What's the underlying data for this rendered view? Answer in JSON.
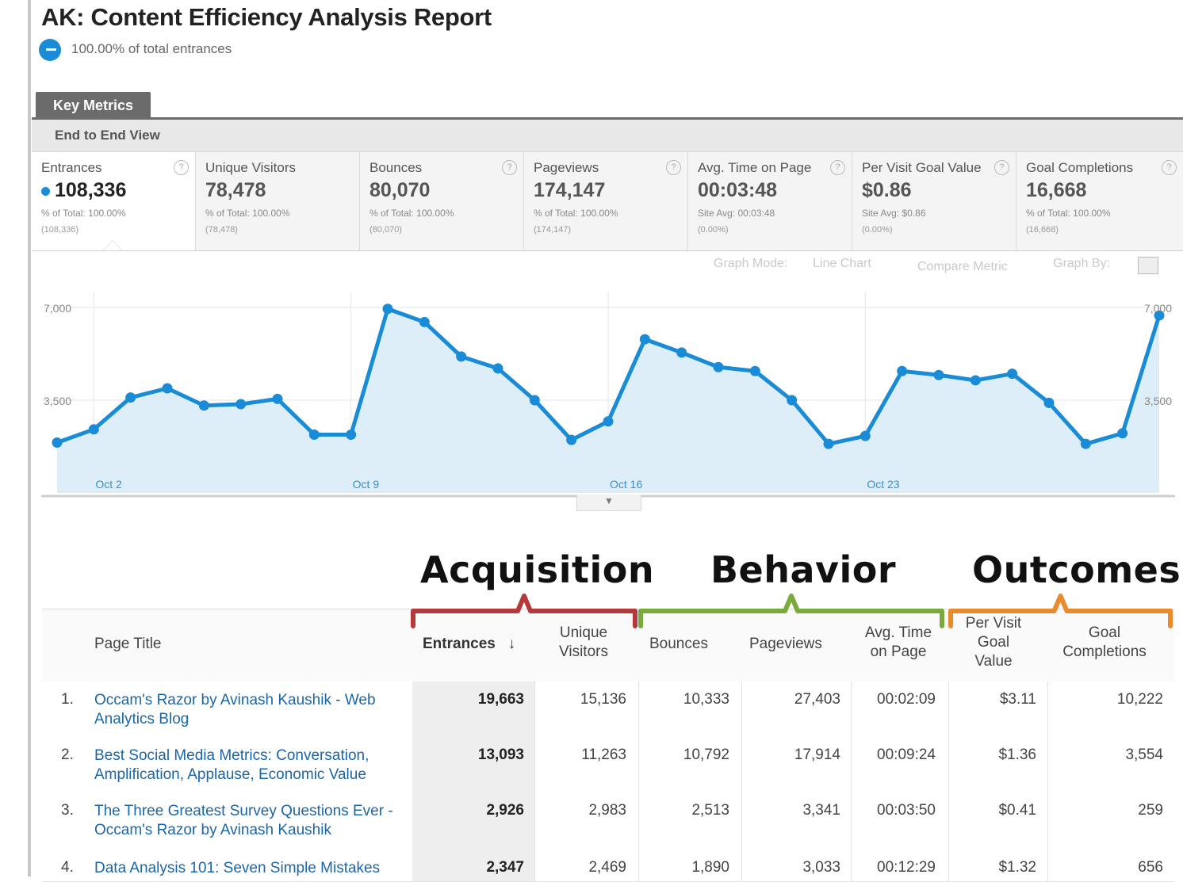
{
  "report": {
    "title": "AK: Content Efficiency Analysis Report",
    "segment_text": "100.00% of total entrances"
  },
  "tabs": {
    "key_metrics": "Key Metrics",
    "view": "End to End View"
  },
  "metrics": [
    {
      "name": "Entrances",
      "value": "108,336",
      "sub1": "% of Total: 100.00%",
      "sub2": "(108,336)"
    },
    {
      "name": "Unique Visitors",
      "value": "78,478",
      "sub1": "% of Total: 100.00%",
      "sub2": "(78,478)"
    },
    {
      "name": "Bounces",
      "value": "80,070",
      "sub1": "% of Total: 100.00%",
      "sub2": "(80,070)"
    },
    {
      "name": "Pageviews",
      "value": "174,147",
      "sub1": "% of Total: 100.00%",
      "sub2": "(174,147)"
    },
    {
      "name": "Avg. Time on Page",
      "value": "00:03:48",
      "sub1": "Site Avg: 00:03:48",
      "sub2": "(0.00%)"
    },
    {
      "name": "Per Visit Goal Value",
      "value": "$0.86",
      "sub1": "Site Avg: $0.86",
      "sub2": "(0.00%)"
    },
    {
      "name": "Goal Completions",
      "value": "16,668",
      "sub1": "% of Total: 100.00%",
      "sub2": "(16,668)"
    }
  ],
  "graph_controls": {
    "mode_label": "Graph Mode:",
    "mode_value": "Line Chart",
    "compare": "Compare Metric",
    "graph_by": "Graph By:"
  },
  "chart_data": {
    "type": "area",
    "series": [
      {
        "values": [
          1900,
          2400,
          3600,
          3950,
          3300,
          3350,
          3550,
          2200,
          2200,
          6950,
          6450,
          5150,
          4700,
          3500,
          2000,
          2700,
          5800,
          5300,
          4750,
          4600,
          3500,
          1850,
          2150,
          4600,
          4450,
          4250,
          4500,
          3400,
          1850,
          2250,
          6700
        ]
      }
    ],
    "y_ticks": [
      "7,000",
      "3,500"
    ],
    "ylim": [
      0,
      7600
    ],
    "x_labels": [
      {
        "index": 1,
        "label": "Oct 2"
      },
      {
        "index": 8,
        "label": "Oct 9"
      },
      {
        "index": 15,
        "label": "Oct 16"
      },
      {
        "index": 22,
        "label": "Oct 23"
      }
    ],
    "color": "#1a8bd6",
    "fill": "#ddeef9",
    "grid": true
  },
  "sections": {
    "acquisition": {
      "label": "Acquisition",
      "color": "#b5383a"
    },
    "behavior": {
      "label": "Behavior",
      "color": "#7aaa3c"
    },
    "outcomes": {
      "label": "Outcomes",
      "color": "#e98a2c"
    }
  },
  "table": {
    "headers": {
      "page_title": "Page Title",
      "entrances": "Entrances",
      "unique_visitors": "Unique Visitors",
      "bounces": "Bounces",
      "pageviews": "Pageviews",
      "avg_time": "Avg. Time on Page",
      "per_visit_goal_value": "Per Visit Goal Value",
      "goal_completions": "Goal Completions"
    },
    "rows": [
      {
        "idx": "1.",
        "title": "Occam's Razor by Avinash Kaushik - Web Analytics Blog",
        "entrances": "19,663",
        "unique": "15,136",
        "bounces": "10,333",
        "pageviews": "27,403",
        "avg_time": "00:02:09",
        "goal_value": "$3.11",
        "goal_completions": "10,222"
      },
      {
        "idx": "2.",
        "title": "Best Social Media Metrics: Conversation, Amplification, Applause, Economic Value",
        "entrances": "13,093",
        "unique": "11,263",
        "bounces": "10,792",
        "pageviews": "17,914",
        "avg_time": "00:09:24",
        "goal_value": "$1.36",
        "goal_completions": "3,554"
      },
      {
        "idx": "3.",
        "title": "The Three Greatest Survey Questions Ever - Occam's Razor by Avinash Kaushik",
        "entrances": "2,926",
        "unique": "2,983",
        "bounces": "2,513",
        "pageviews": "3,341",
        "avg_time": "00:03:50",
        "goal_value": "$0.41",
        "goal_completions": "259"
      },
      {
        "idx": "4.",
        "title": "Data Analysis 101: Seven Simple Mistakes",
        "entrances": "2,347",
        "unique": "2,469",
        "bounces": "1,890",
        "pageviews": "3,033",
        "avg_time": "00:12:29",
        "goal_value": "$1.32",
        "goal_completions": "656"
      }
    ]
  }
}
